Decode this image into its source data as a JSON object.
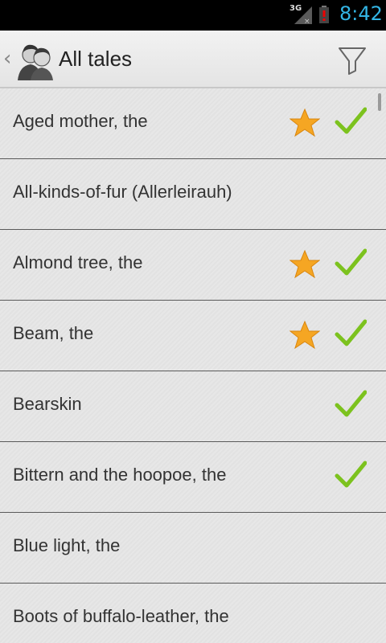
{
  "status_bar": {
    "network": "3G",
    "time": "8:42"
  },
  "action_bar": {
    "title": "All tales",
    "up_icon": "chevron-left-icon",
    "logo_icon": "brothers-grimm-portrait-icon",
    "filter_icon": "filter-icon"
  },
  "tales": [
    {
      "title": "Aged mother, the",
      "favorite": true,
      "read": true
    },
    {
      "title": "All-kinds-of-fur (Allerleirauh)",
      "favorite": false,
      "read": false
    },
    {
      "title": "Almond tree, the",
      "favorite": true,
      "read": true
    },
    {
      "title": "Beam, the",
      "favorite": true,
      "read": true
    },
    {
      "title": "Bearskin",
      "favorite": false,
      "read": true
    },
    {
      "title": "Bittern and the hoopoe, the",
      "favorite": false,
      "read": true
    },
    {
      "title": "Blue light, the",
      "favorite": false,
      "read": false
    },
    {
      "title": "Boots of buffalo-leather, the",
      "favorite": false,
      "read": false
    }
  ],
  "colors": {
    "accent_time": "#33b5e5",
    "star": "#f5a623",
    "check": "#7cc21e"
  }
}
